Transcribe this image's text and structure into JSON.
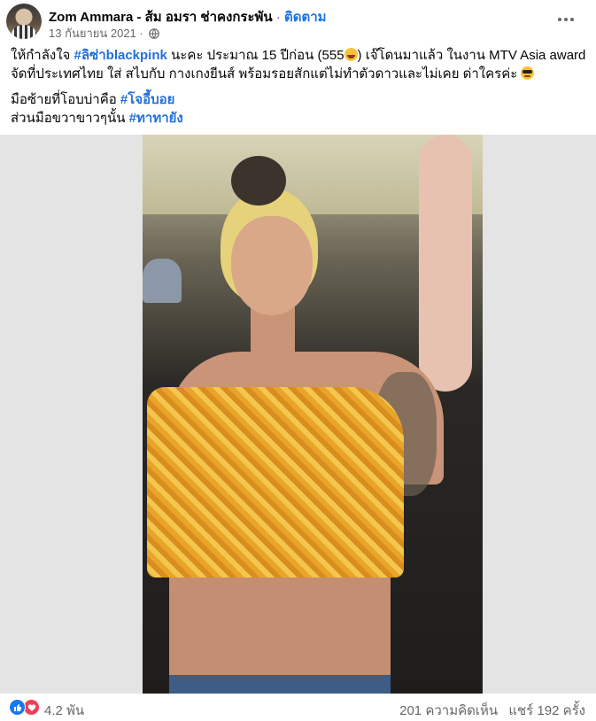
{
  "post": {
    "author": "Zom Ammara - ส้ม อมรา ช่าคงกระพัน",
    "separator": "·",
    "follow_label": "ติดตาม",
    "date": "13 กันยายน 2021",
    "date_separator": "·",
    "privacy_icon": "globe-icon"
  },
  "text": {
    "l1_a": "ให้กำลังใจ ",
    "l1_tag": "#ลิซ่าblackpink",
    "l1_b": " นะคะ ประมาณ 15 ปีก่อน (555",
    "l1_c": ") เจ๊โดนมาแล้ว ในงาน MTV Asia award จัดที่ประเทศไทย ใส่ สไบกับ กางเกงยีนส์ พร้อมรอยสักแต่ไม่ทำตัวดาวและไม่เคย ด่าใครค่ะ ",
    "l2_a": "มือซ้ายที่โอบบ่าคือ ",
    "l2_tag": "#โจอี้บอย",
    "l3_a": "ส่วนมือขวาขาวๆนั้น ",
    "l3_tag": "#ทาทายัง"
  },
  "footer": {
    "reactions_count": "4.2 พัน",
    "comments": "201 ความคิดเห็น",
    "shares": "แชร์ 192 ครั้ง"
  },
  "colors": {
    "accent": "#1b74e4",
    "hashtag": "#216fdb",
    "muted": "#65676b",
    "like": "#1877f2",
    "love": "#f33e58"
  }
}
